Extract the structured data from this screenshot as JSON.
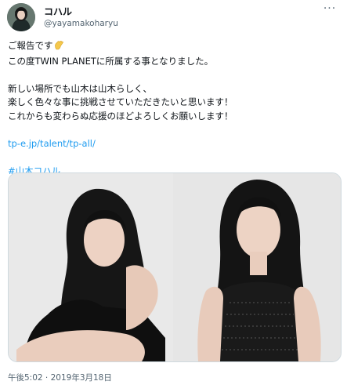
{
  "user": {
    "display_name": "コハル",
    "handle": "@yayamakoharyu"
  },
  "menu": {
    "more_glyph": "···"
  },
  "tweet": {
    "line1": "ご報告です",
    "line1_emoji": "clapping-hands-icon",
    "line2": "この度TWIN PLANETに所属する事となりました。",
    "line3": "新しい場所でも山木は山木らしく、",
    "line4": "楽しく色々な事に挑戦させていただきたいと思います！",
    "line5": "これからも変わらぬ応援のほどよろしくお願いします！",
    "link": "tp-e.jp/talent/tp-all/",
    "hashtag": "#山木コハル"
  },
  "timestamp": "午後5:02 · 2019年3月18日",
  "colors": {
    "link": "#1d9bf0",
    "text": "#0f1419",
    "muted": "#536471",
    "border": "#cfd9de"
  }
}
